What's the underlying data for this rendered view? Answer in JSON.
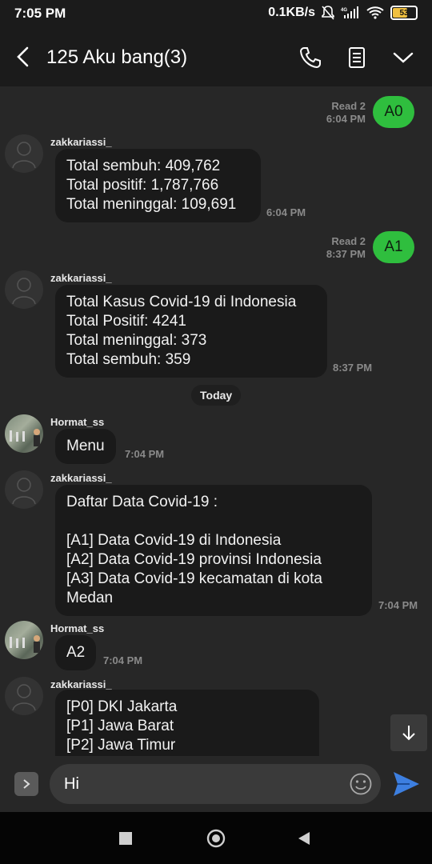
{
  "status_bar": {
    "time": "7:05 PM",
    "speed": "0.1KB/s",
    "network": "4G",
    "battery": "53"
  },
  "header": {
    "title": "125 Aku bang(3)"
  },
  "messages": [
    {
      "type": "sent",
      "text": "A0",
      "read": "Read 2",
      "time": "6:04 PM"
    },
    {
      "type": "received",
      "sender": "zakkariassi_",
      "text": "Total sembuh: 409,762\nTotal positif: 1,787,766\nTotal meninggal: 109,691",
      "time": "6:04 PM"
    },
    {
      "type": "sent",
      "text": "A1",
      "read": "Read 2",
      "time": "8:37 PM"
    },
    {
      "type": "received",
      "sender": "zakkariassi_",
      "text": "Total Kasus Covid-19 di Indonesia\nTotal Positif: 4241\nTotal meninggal: 373\nTotal sembuh: 359",
      "time": "8:37 PM"
    },
    {
      "type": "received",
      "sender": "Hormat_ss",
      "text": "Menu",
      "time": "7:04 PM"
    },
    {
      "type": "received",
      "sender": "zakkariassi_",
      "text": "Daftar Data Covid-19 :\n\n[A1] Data Covid-19 di Indonesia\n[A2] Data Covid-19 provinsi Indonesia\n[A3] Data Covid-19 kecamatan di kota\nMedan",
      "time": "7:04 PM"
    },
    {
      "type": "received",
      "sender": "Hormat_ss",
      "text": "A2",
      "time": "7:04 PM"
    },
    {
      "type": "received",
      "sender": "zakkariassi_",
      "text": "[P0] DKI Jakarta\n[P1] Jawa Barat\n[P2] Jawa Timur"
    }
  ],
  "date_divider": "Today",
  "composer": {
    "value": "Hi"
  },
  "icons": {
    "back": "back-arrow-icon",
    "call": "phone-icon",
    "details": "document-icon",
    "more": "chevron-down-icon",
    "send": "send-icon",
    "emoji": "emoji-icon"
  },
  "colors": {
    "sent_bubble": "#2fbe3e",
    "received_bubble": "#1a1a1a",
    "background": "#272727"
  }
}
